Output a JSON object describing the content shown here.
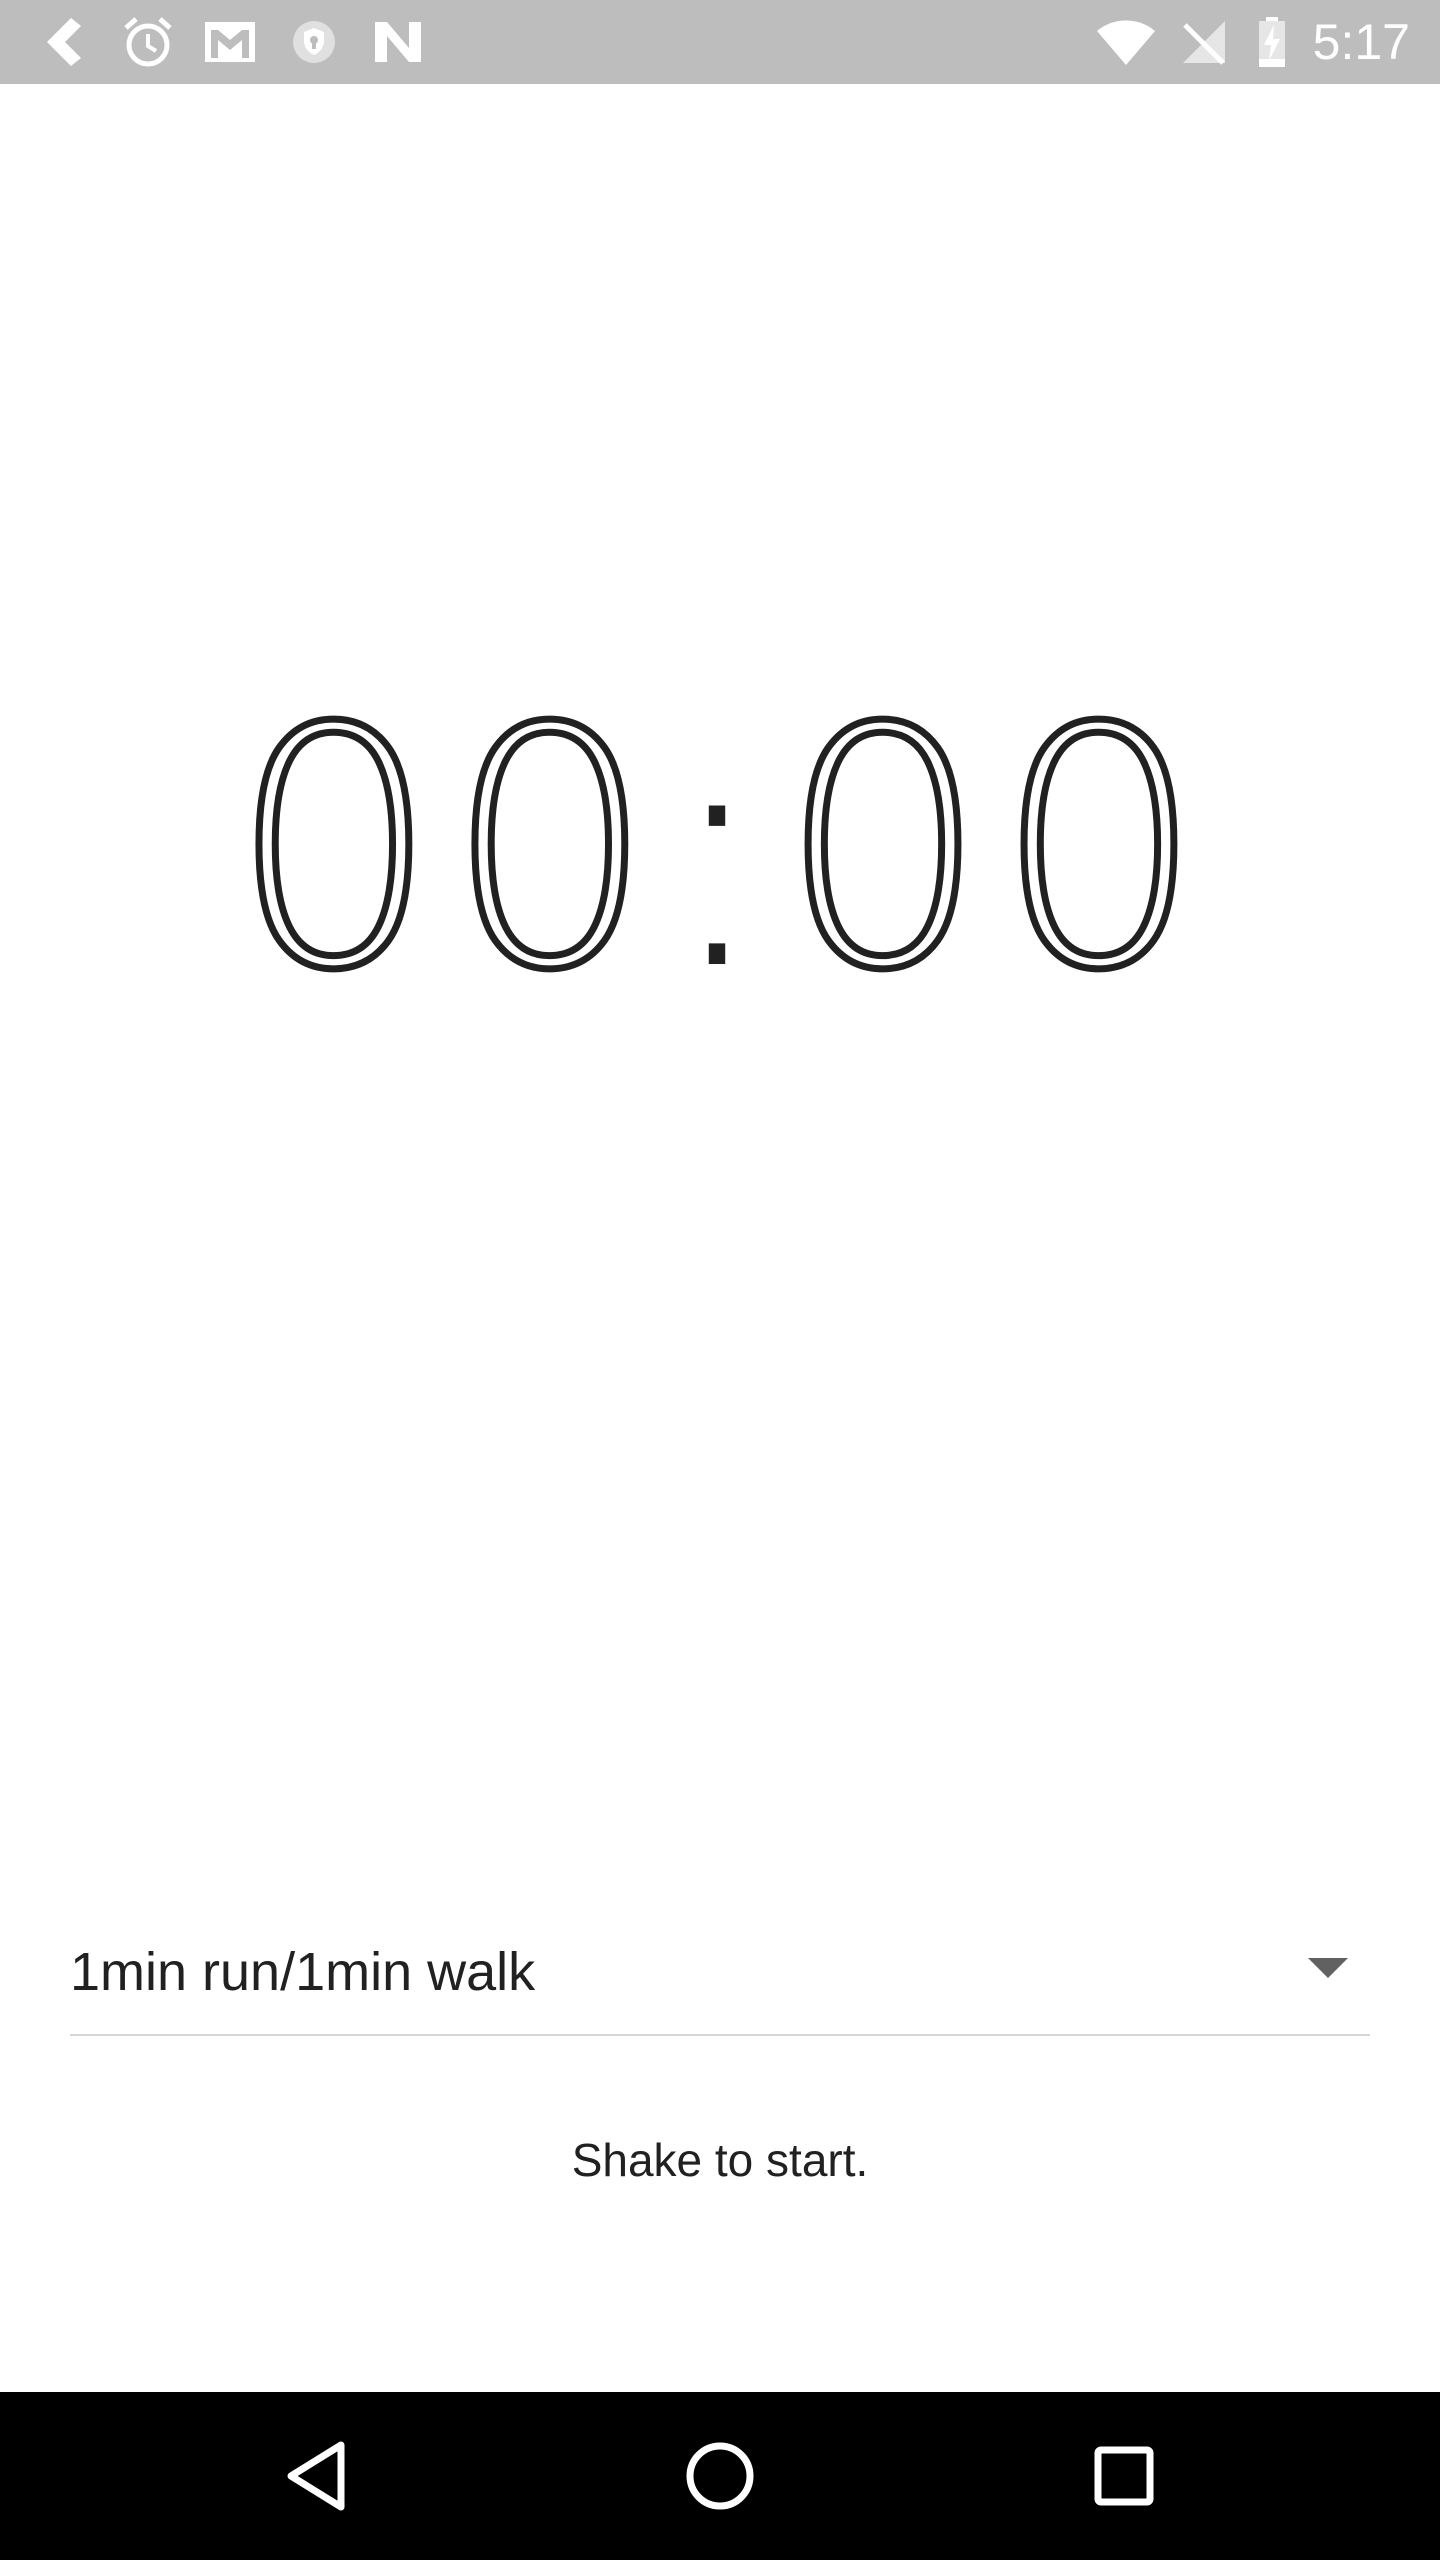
{
  "status_bar": {
    "time": "5:17",
    "left_icons": [
      "back-arrow-icon",
      "alarm-icon",
      "gmail-icon",
      "shield-icon",
      "n-logo-icon"
    ],
    "right_icons": [
      "wifi-icon",
      "no-signal-icon",
      "battery-charging-icon"
    ],
    "background": "#bdbdbd"
  },
  "timer": {
    "minutes": "00",
    "separator": ":",
    "seconds": "00"
  },
  "interval_select": {
    "value": "1min run/1min walk",
    "icon": "dropdown-arrow-icon"
  },
  "hint": {
    "text": "Shake to start."
  },
  "nav_bar": {
    "buttons": [
      "back-icon",
      "home-icon",
      "recents-icon"
    ],
    "background": "#000000"
  }
}
